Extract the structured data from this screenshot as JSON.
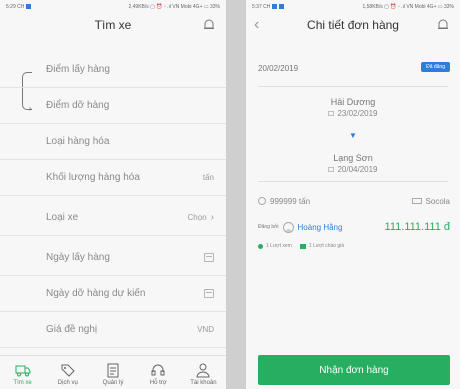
{
  "left": {
    "status": {
      "time": "5:29 CH",
      "right": "2,49KB/s ▢ ⏰ ▫ .ıl VN Mobi 4G+ ▭ 33%"
    },
    "header": {
      "title": "Tìm xe"
    },
    "fields": {
      "pickup": "Điểm lấy hàng",
      "dropoff": "Điểm dỡ hàng",
      "goods_type": "Loại hàng hóa",
      "weight": "Khối lượng hàng hóa",
      "weight_unit": "tấn",
      "vehicle_type": "Loại xe",
      "vehicle_choose": "Chọn",
      "pickup_date": "Ngày lấy hàng",
      "dropoff_date": "Ngày dỡ hàng dự kiến",
      "price": "Giá đề nghị",
      "price_unit": "VND"
    },
    "tabs": [
      {
        "label": "Tìm xe"
      },
      {
        "label": "Dịch vụ"
      },
      {
        "label": "Quản lý"
      },
      {
        "label": "Hỗ trợ"
      },
      {
        "label": "Tài khoản"
      }
    ]
  },
  "right": {
    "status": {
      "time": "5:37 CH",
      "right": "1,58KB/s ▢ ⏰ ▫ .ıl VN Mobi 4G+ ▭ 33%"
    },
    "header": {
      "title": "Chi tiết đơn hàng"
    },
    "order": {
      "date": "20/02/2019",
      "badge": "Đã đăng",
      "from_place": "Hải Dương",
      "from_date": "23/02/2019",
      "to_place": "Lạng Sơn",
      "to_date": "20/04/2019",
      "weight": "999999 tấn",
      "goods": "Socola",
      "posted_by_label": "Đăng bởi",
      "poster_name": "Hoàng Hằng",
      "price": "111.111.111 đ",
      "views": "1 Lượt xem",
      "quotes": "1 Lượt chào giá"
    },
    "cta": "Nhận đơn hàng"
  },
  "colors": {
    "accent_green": "#27ae60",
    "accent_blue": "#2e7ddb"
  }
}
